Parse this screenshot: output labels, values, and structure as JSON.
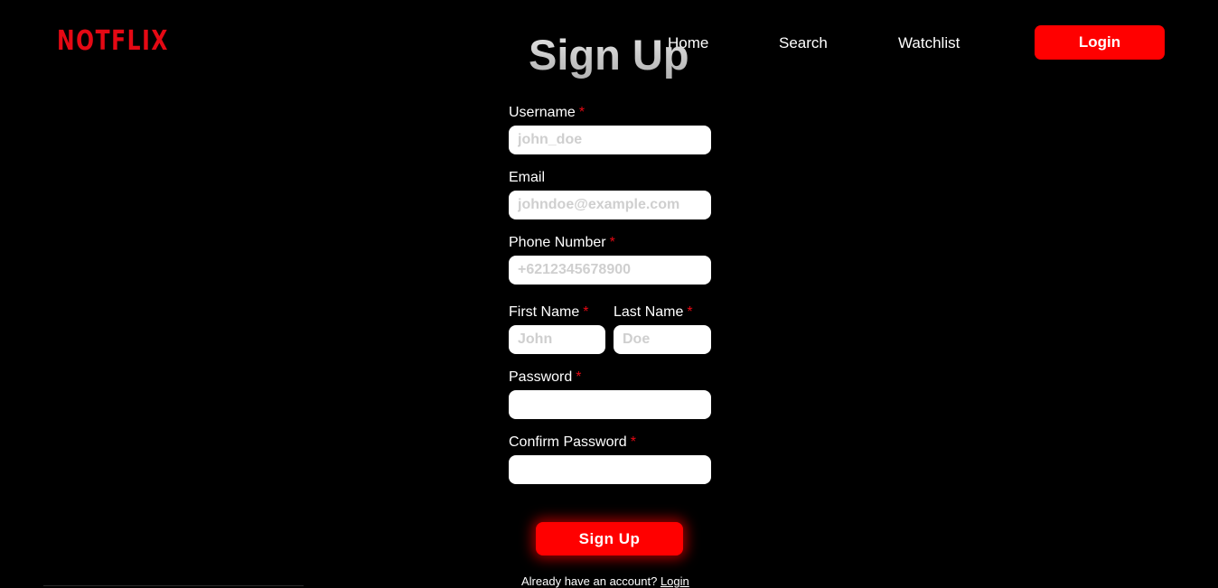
{
  "brand": {
    "logo": "NOTFLIX",
    "accent_color": "#e50914",
    "button_color": "#ff0000"
  },
  "nav": {
    "home": "Home",
    "search": "Search",
    "watchlist": "Watchlist",
    "login": "Login"
  },
  "form": {
    "title": "Sign Up",
    "required_mark": "*",
    "username": {
      "label": "Username",
      "placeholder": "john_doe",
      "value": ""
    },
    "email": {
      "label": "Email",
      "placeholder": "johndoe@example.com",
      "value": ""
    },
    "phone": {
      "label": "Phone Number",
      "placeholder": "+6212345678900",
      "value": ""
    },
    "first_name": {
      "label": "First Name",
      "placeholder": "John",
      "value": ""
    },
    "last_name": {
      "label": "Last Name",
      "placeholder": "Doe",
      "value": ""
    },
    "password": {
      "label": "Password",
      "placeholder": "",
      "value": ""
    },
    "confirm_password": {
      "label": "Confirm Password",
      "placeholder": "",
      "value": ""
    },
    "submit": "Sign Up",
    "footer_text": "Already have an account?",
    "footer_link": "Login"
  }
}
